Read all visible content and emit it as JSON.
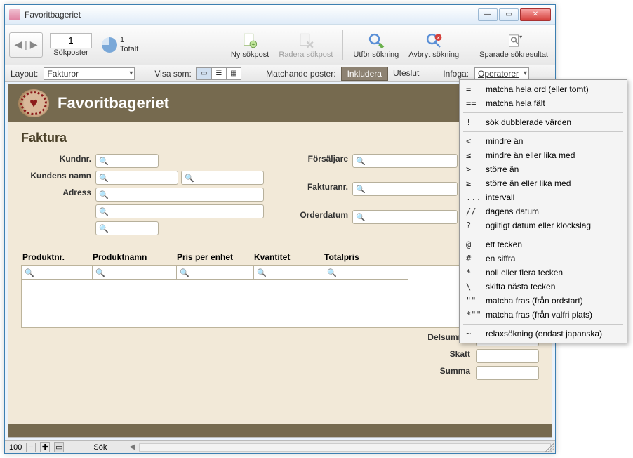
{
  "titlebar": {
    "title": "Favoritbageriet"
  },
  "toolbar": {
    "record_value": "1",
    "total_count": "1",
    "total_label": "Totalt",
    "sokposter": "Sökposter",
    "ny_sokpost": "Ny sökpost",
    "radera_sokpost": "Radera sökpost",
    "utfor": "Utför sökning",
    "avbryt": "Avbryt sökning",
    "sparade": "Sparade sökresultat"
  },
  "subbar": {
    "layout_label": "Layout:",
    "layout_value": "Fakturor",
    "visa_som": "Visa som:",
    "matchande": "Matchande poster:",
    "inkludera": "Inkludera",
    "uteslut": "Uteslut",
    "infoga": "Infoga:",
    "operatorer": "Operatorer"
  },
  "banner": {
    "brand": "Favoritbageriet"
  },
  "form": {
    "section": "Faktura",
    "kundnr": "Kundnr.",
    "kundnamn": "Kundens namn",
    "adress": "Adress",
    "forsaljare": "Försäljare",
    "fakturanr": "Fakturanr.",
    "orderdatum": "Orderdatum",
    "produktnr": "Produktnr.",
    "produktnamn": "Produktnamn",
    "pris": "Pris per enhet",
    "kvantitet": "Kvantitet",
    "totalpris": "Totalpris",
    "delsumma": "Delsumma",
    "skatt": "Skatt",
    "summa": "Summa"
  },
  "status": {
    "zoom": "100",
    "mode": "Sök"
  },
  "menu": {
    "items": [
      {
        "op": "=",
        "label": "matcha hela ord (eller tomt)"
      },
      {
        "op": "==",
        "label": "matcha hela fält"
      },
      {
        "sep": true
      },
      {
        "op": "!",
        "label": "sök dubblerade värden"
      },
      {
        "sep": true
      },
      {
        "op": "<",
        "label": "mindre än"
      },
      {
        "op": "≤",
        "label": "mindre än eller lika med"
      },
      {
        "op": ">",
        "label": "större än"
      },
      {
        "op": "≥",
        "label": "större än eller lika med"
      },
      {
        "op": "...",
        "label": "intervall"
      },
      {
        "op": "//",
        "label": "dagens datum"
      },
      {
        "op": "?",
        "label": "ogiltigt datum eller klockslag"
      },
      {
        "sep": true
      },
      {
        "op": "@",
        "label": "ett tecken"
      },
      {
        "op": "#",
        "label": "en siffra"
      },
      {
        "op": "*",
        "label": "noll eller flera tecken"
      },
      {
        "op": "\\",
        "label": "skifta nästa tecken"
      },
      {
        "op": "\"\"",
        "label": "matcha fras (från ordstart)"
      },
      {
        "op": "*\"\"",
        "label": "matcha fras (från valfri plats)"
      },
      {
        "sep": true
      },
      {
        "op": "~",
        "label": "relaxsökning (endast japanska)"
      }
    ]
  }
}
